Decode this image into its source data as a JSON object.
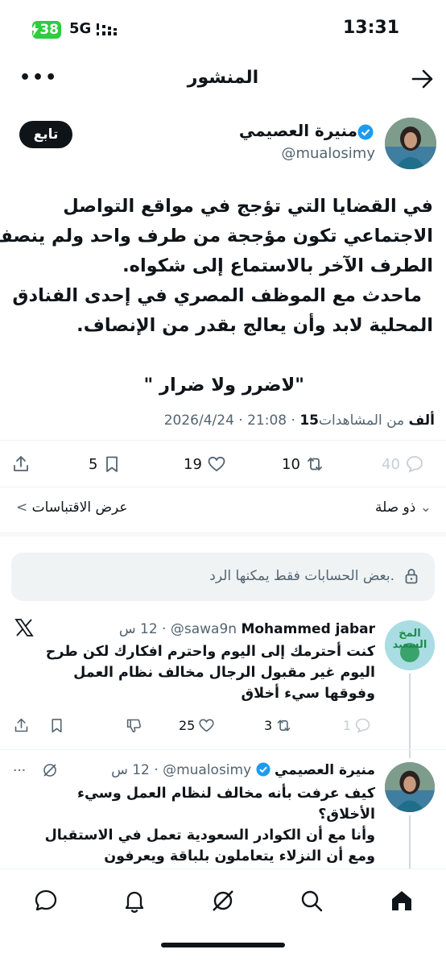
{
  "status_bar": {
    "battery": "38",
    "network": "5G",
    "time": "13:31"
  },
  "header": {
    "title": "المنشور",
    "back_icon": "arrow-right-icon",
    "more_icon": "more-dots-icon",
    "more_label": "•••"
  },
  "author": {
    "name": "منيرة العصيمي",
    "handle": "@mualosimy",
    "follow_label": "تابع"
  },
  "post": {
    "lines": [
      "في القضايا التي تؤجج في مواقع التواصل",
      "الاجتماعي تكون مؤججة من طرف واحد ولم ينصف",
      "الطرف الآخر بالاستماع إلى شكواه.",
      "ماحدث مع الموظف المصري في إحدى الفنادق",
      "المحلية لابد وأن يعالج بقدر من الإنصاف.",
      "",
      "\"لاضرر ولا ضرار \""
    ],
    "meta_prefix": "2026/4/24 · 21:08 · ",
    "views_count": "15ألف",
    "views_label": " من المشاهدات"
  },
  "actions": {
    "replies": "40",
    "reposts": "10",
    "likes": "19",
    "bookmarks": "5"
  },
  "quotes": {
    "relevance_label": "ذو صلة",
    "view_quotes_label": "عرض الاقتباسات"
  },
  "restricted": {
    "text": "بعض الحسابات فقط يمكنها الرد."
  },
  "reply1": {
    "name": "Mohammed jabar",
    "handle": "@sawa9n",
    "time": "12 س",
    "avatar_text": "المخ السعيد",
    "lines": [
      "كنت أحترمك إلى اليوم واحترم افكارك لكن طرح",
      "اليوم غير مقبول الرجال مخالف نظام العمل",
      "وفوقها سيء أخلاق"
    ],
    "replies": "1",
    "reposts": "3",
    "likes": "25"
  },
  "reply2": {
    "name": "منيرة العصيمي",
    "handle": "@mualosimy",
    "time": "12 س",
    "lines": [
      "كيف عرفت بأنه مخالف لنظام العمل وسيء",
      "الأخلاق؟",
      "وأنا مع أن الكوادر السعودية تعمل في الاستقبال",
      "ومع أن النزلاء يتعاملون بلباقة ويعرفون"
    ]
  },
  "bottom_nav": [
    "home-icon",
    "search-icon",
    "grok-icon",
    "notifications-icon",
    "messages-icon"
  ],
  "colors": {
    "text": "#0f1419",
    "muted": "#536471",
    "verified": "#1d9bf0",
    "battery": "#2ecc40"
  }
}
